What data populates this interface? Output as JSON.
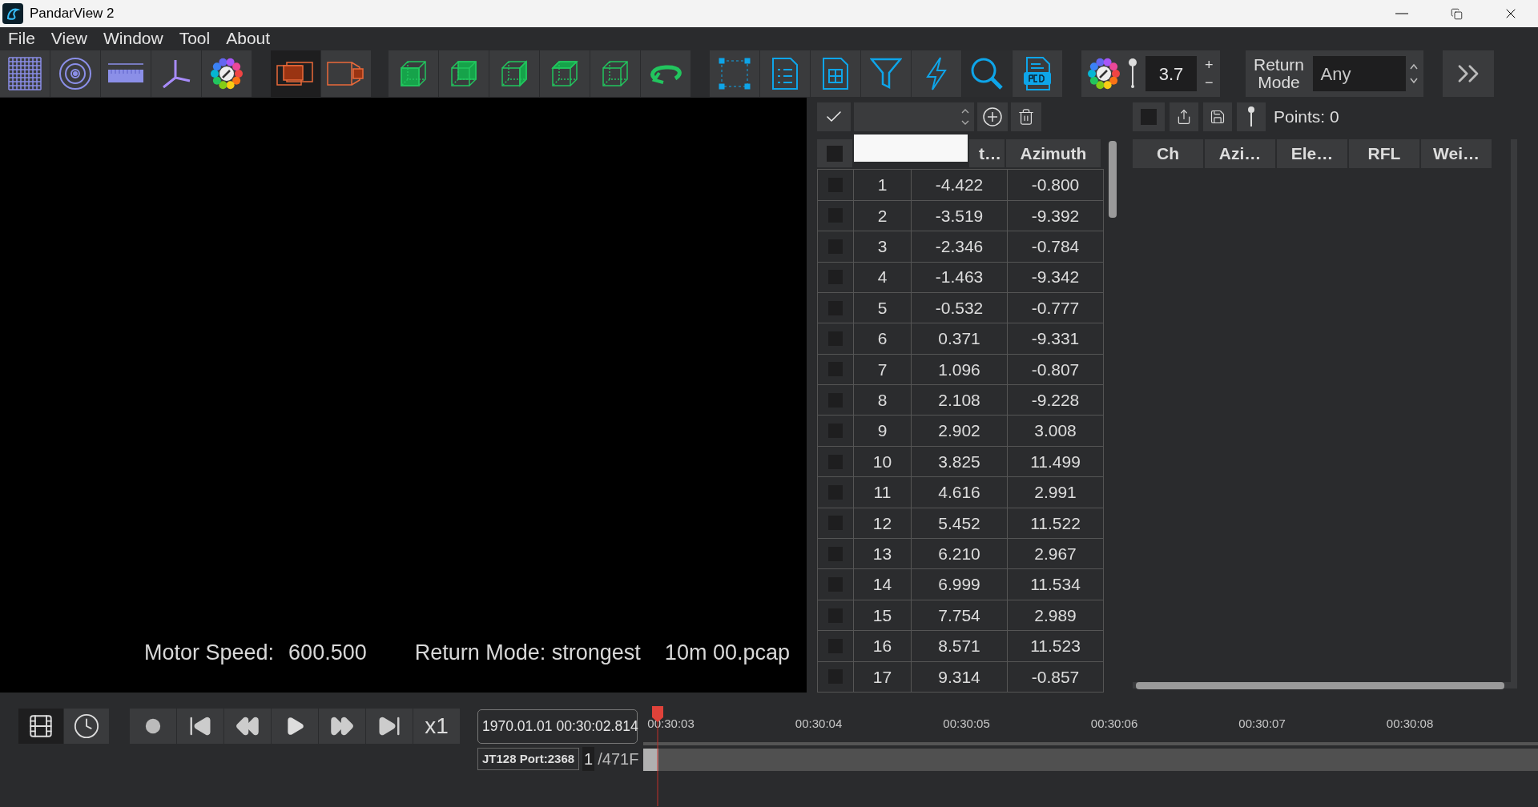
{
  "window": {
    "title": "PandarView 2"
  },
  "menu": [
    "File",
    "View",
    "Window",
    "Tool",
    "About"
  ],
  "view_toggles": [
    {
      "selected": true
    },
    {
      "selected": false
    }
  ],
  "point_size": {
    "value": "3.7",
    "plus": "+",
    "minus": "−"
  },
  "return_mode": {
    "label": "Return Mode",
    "value": "Any"
  },
  "table": {
    "all_checked": false,
    "columns": [
      "t…",
      "Azimuth"
    ],
    "rows": [
      {
        "id": "1",
        "column_3": "-4.422",
        "azimuth": "-0.800",
        "checked": false
      },
      {
        "id": "2",
        "column_3": "-3.519",
        "azimuth": "-9.392",
        "checked": false
      },
      {
        "id": "3",
        "column_3": "-2.346",
        "azimuth": "-0.784",
        "checked": false
      },
      {
        "id": "4",
        "column_3": "-1.463",
        "azimuth": "-9.342",
        "checked": false
      },
      {
        "id": "5",
        "column_3": "-0.532",
        "azimuth": "-0.777",
        "checked": false
      },
      {
        "id": "6",
        "column_3": "0.371",
        "azimuth": "-9.331",
        "checked": false
      },
      {
        "id": "7",
        "column_3": "1.096",
        "azimuth": "-0.807",
        "checked": false
      },
      {
        "id": "8",
        "column_3": "2.108",
        "azimuth": "-9.228",
        "checked": false
      },
      {
        "id": "9",
        "column_3": "2.902",
        "azimuth": "3.008",
        "checked": false
      },
      {
        "id": "10",
        "column_3": "3.825",
        "azimuth": "11.499",
        "checked": false
      },
      {
        "id": "11",
        "column_3": "4.616",
        "azimuth": "2.991",
        "checked": false
      },
      {
        "id": "12",
        "column_3": "5.452",
        "azimuth": "11.522",
        "checked": false
      },
      {
        "id": "13",
        "column_3": "6.210",
        "azimuth": "2.967",
        "checked": false
      },
      {
        "id": "14",
        "column_3": "6.999",
        "azimuth": "11.534",
        "checked": false
      },
      {
        "id": "15",
        "column_3": "7.754",
        "azimuth": "2.989",
        "checked": false
      },
      {
        "id": "16",
        "column_3": "8.571",
        "azimuth": "11.523",
        "checked": false
      },
      {
        "id": "17",
        "column_3": "9.314",
        "azimuth": "-0.857",
        "checked": false
      }
    ]
  },
  "points_panel": {
    "select_all_checked": false,
    "points": "Points: 0",
    "columns": [
      "Ch",
      "Azi…",
      "Ele…",
      "RFL",
      "Wei…"
    ]
  },
  "overlay": {
    "motor_label": "Motor Speed:",
    "motor_value": "600.500",
    "return_mode": "Return Mode: strongest",
    "file": "10m 00.pcap"
  },
  "playback": {
    "mode_toggles": [
      {
        "selected": true
      },
      {
        "selected": false
      }
    ],
    "speed": "x1",
    "timestamp": "1970.01.01 00:30:02.814",
    "device": "JT128 Port:2368",
    "frame": "1",
    "frame_total": "/471F",
    "ticks": [
      "00:30:03",
      "00:30:04",
      "00:30:05",
      "00:30:06",
      "00:30:07",
      "00:30:08"
    ]
  }
}
